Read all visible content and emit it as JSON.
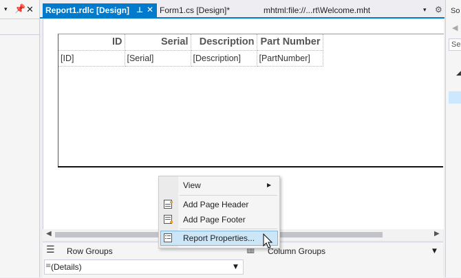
{
  "tabs": [
    {
      "label": "Report1.rdlc [Design]",
      "active": true
    },
    {
      "label": "Form1.cs [Design]*",
      "active": false
    },
    {
      "label": "mhtml:file://...rt\\Welcome.mht",
      "active": false
    }
  ],
  "report_table": {
    "headers": [
      "ID",
      "Serial",
      "Description",
      "Part Number"
    ],
    "row": [
      "[ID]",
      "[Serial]",
      "[Description]",
      "[PartNumber]"
    ]
  },
  "context_menu": {
    "items": [
      {
        "label": "View",
        "icon": "submenu-arrow-icon"
      },
      {
        "label": "Add Page Header",
        "icon": "page-header-icon"
      },
      {
        "label": "Add Page Footer",
        "icon": "page-footer-icon"
      },
      {
        "label": "Report Properties...",
        "icon": "report-properties-icon",
        "highlighted": true
      }
    ]
  },
  "groups": {
    "row_groups_label": "Row Groups",
    "column_groups_label": "Column Groups",
    "details_value": "(Details)"
  },
  "right_pane": {
    "title": "So",
    "search_placeholder": "Se"
  },
  "colors": {
    "accent": "#007acc",
    "selection": "#cde6f7"
  }
}
